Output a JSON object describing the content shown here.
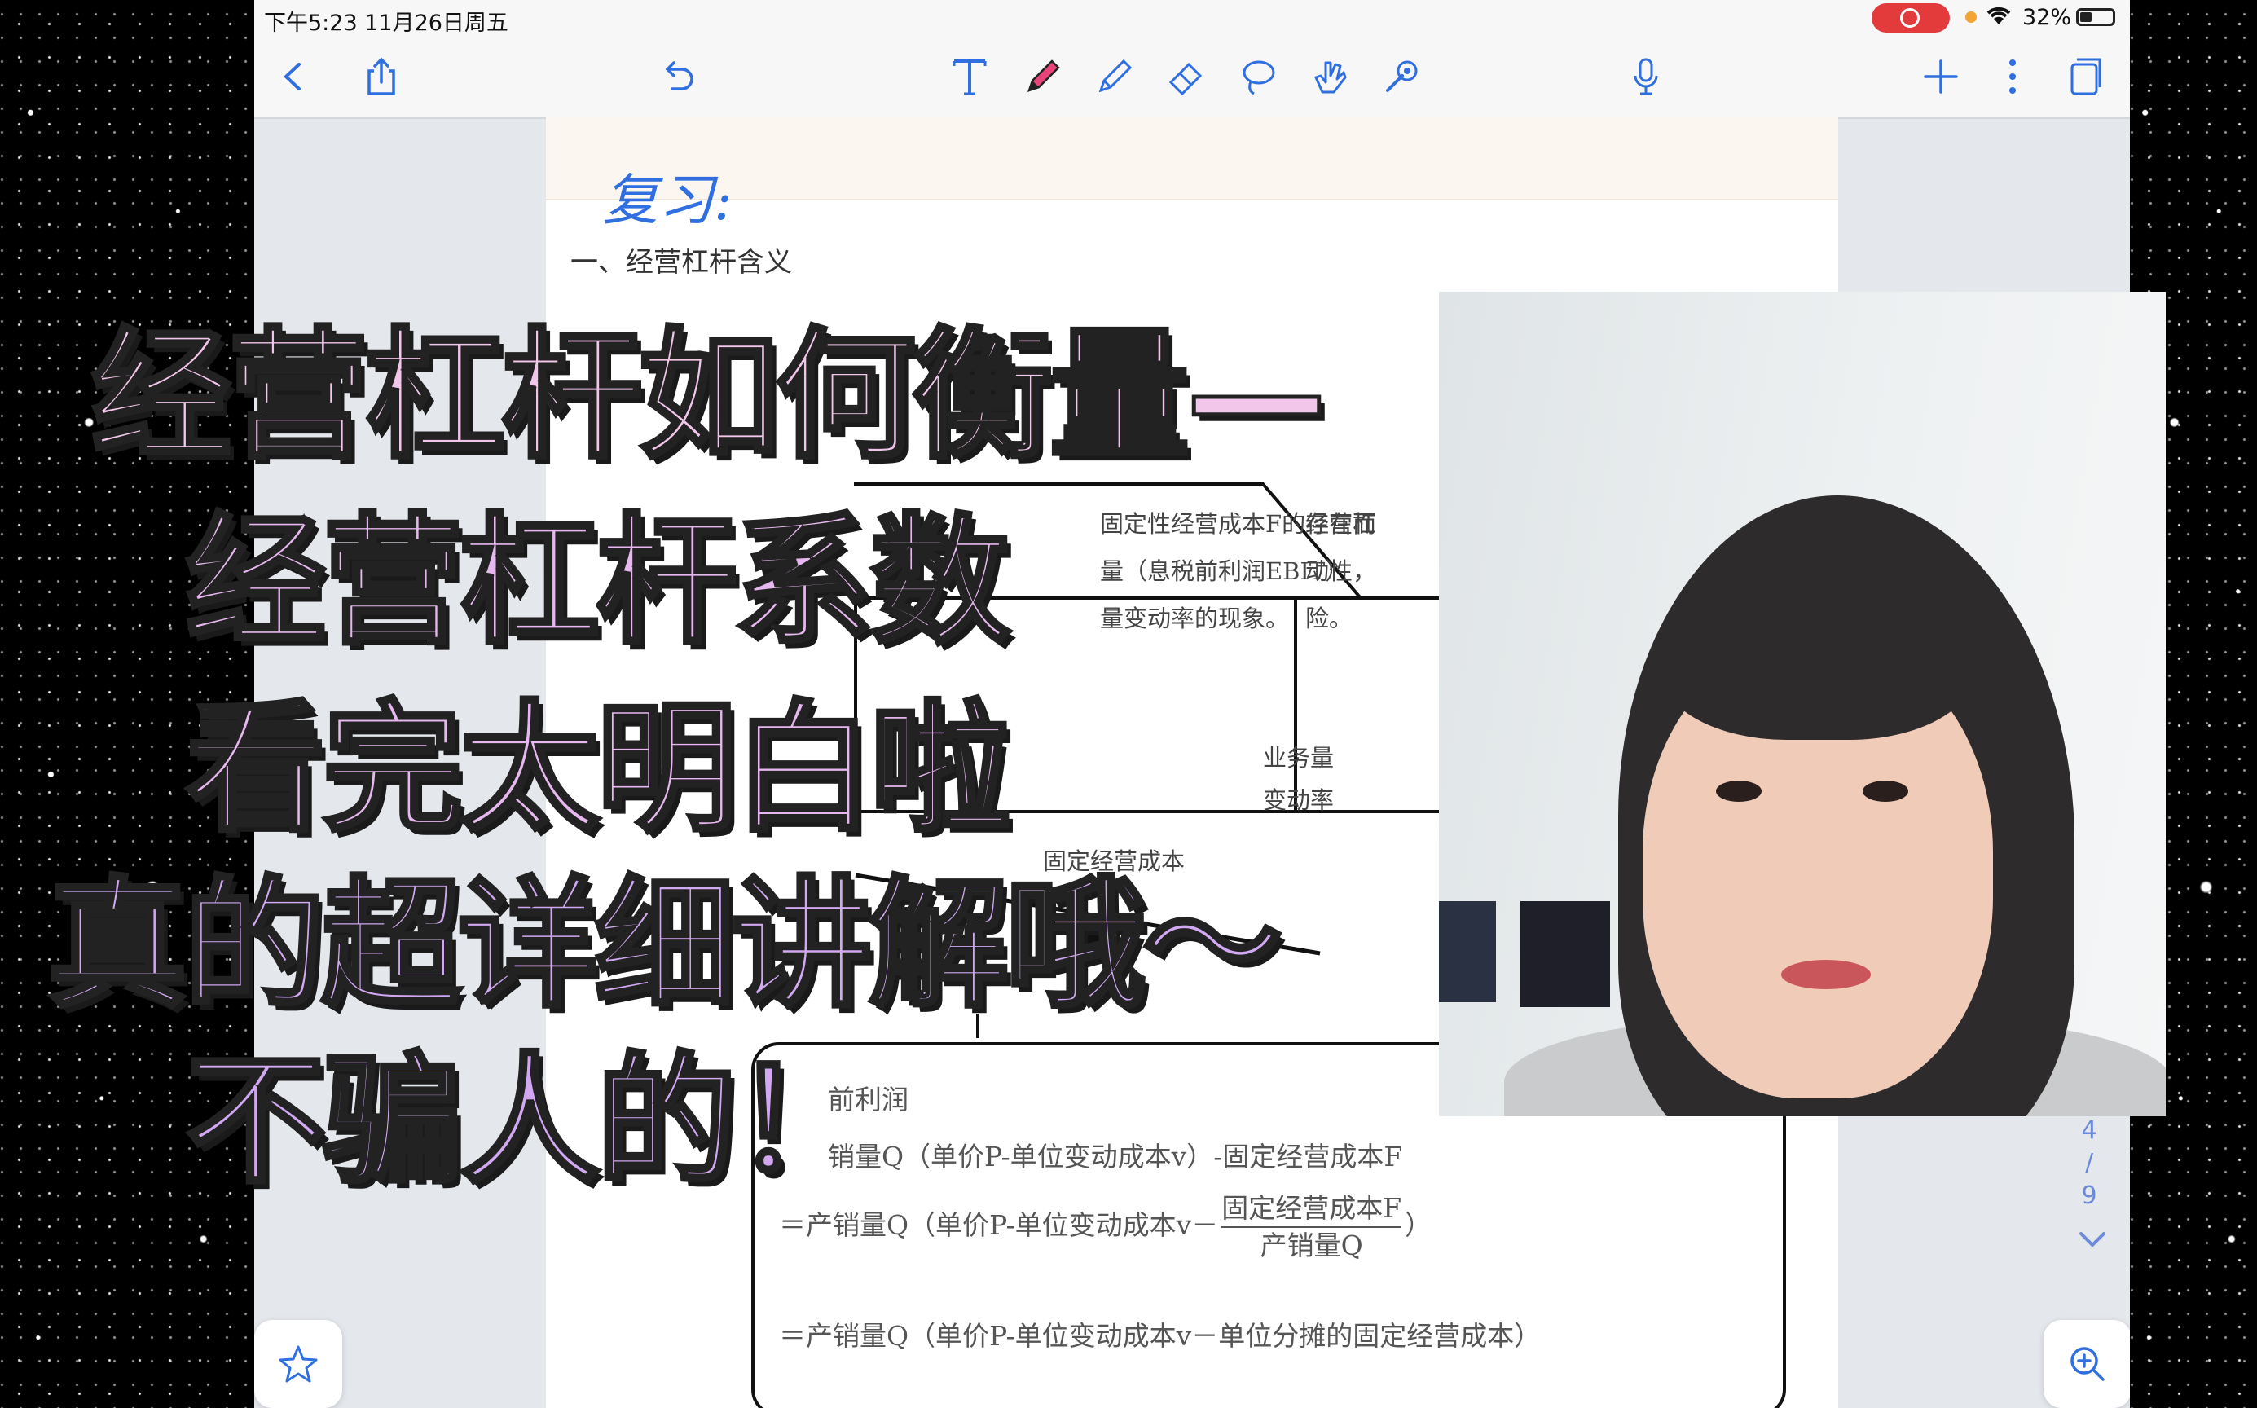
{
  "status_bar": {
    "time": "下午5:23   11月26日周五",
    "battery_percent": "32%"
  },
  "toolbar": {
    "left": [
      "back-icon",
      "share-icon",
      "undo-icon"
    ],
    "tools": [
      "text-tool-icon",
      "pen-icon",
      "highlighter-icon",
      "eraser-icon",
      "lasso-icon",
      "hand-icon",
      "laser-pointer-icon"
    ],
    "right": [
      "microphone-icon",
      "add-icon",
      "more-icon",
      "pages-icon"
    ],
    "accent_color": "#2f6fe0",
    "active_tool_color": "#e8457a"
  },
  "document": {
    "handwritten_note": "复习:",
    "heading": "一、经营杠杆含义",
    "diagram": {
      "box_text_1": [
        "固定性经营成本F的存在而",
        "量（息税前利润EBIT）",
        "量变动率的现象。"
      ],
      "box_text_2": [
        "经营杠",
        "动性，",
        "险。"
      ],
      "lever_right_label": [
        "业务量",
        "变动率"
      ],
      "fulcrum_label": "固定经营成本"
    },
    "formula": {
      "line1": "前利润",
      "line2": "销量Q（单价P-单位变动成本v）-固定经营成本F",
      "line3_prefix": "＝产销量Q（单价P-单位变动成本v－",
      "line3_num": "固定经营成本F",
      "line3_den": "产销量Q",
      "line3_suffix": "）",
      "line4": "＝产销量Q（单价P-单位变动成本v－单位分摊的固定经营成本）"
    }
  },
  "pager": {
    "current": "4",
    "separator": "/",
    "total": "9"
  },
  "overlay_caption": {
    "line1": "经营杠杆如何衡量—",
    "line2": "经营杠杆系数",
    "line3": "看完太明白啦",
    "line4": "真的超详细讲解哦～",
    "line5": "不骗人的！"
  }
}
